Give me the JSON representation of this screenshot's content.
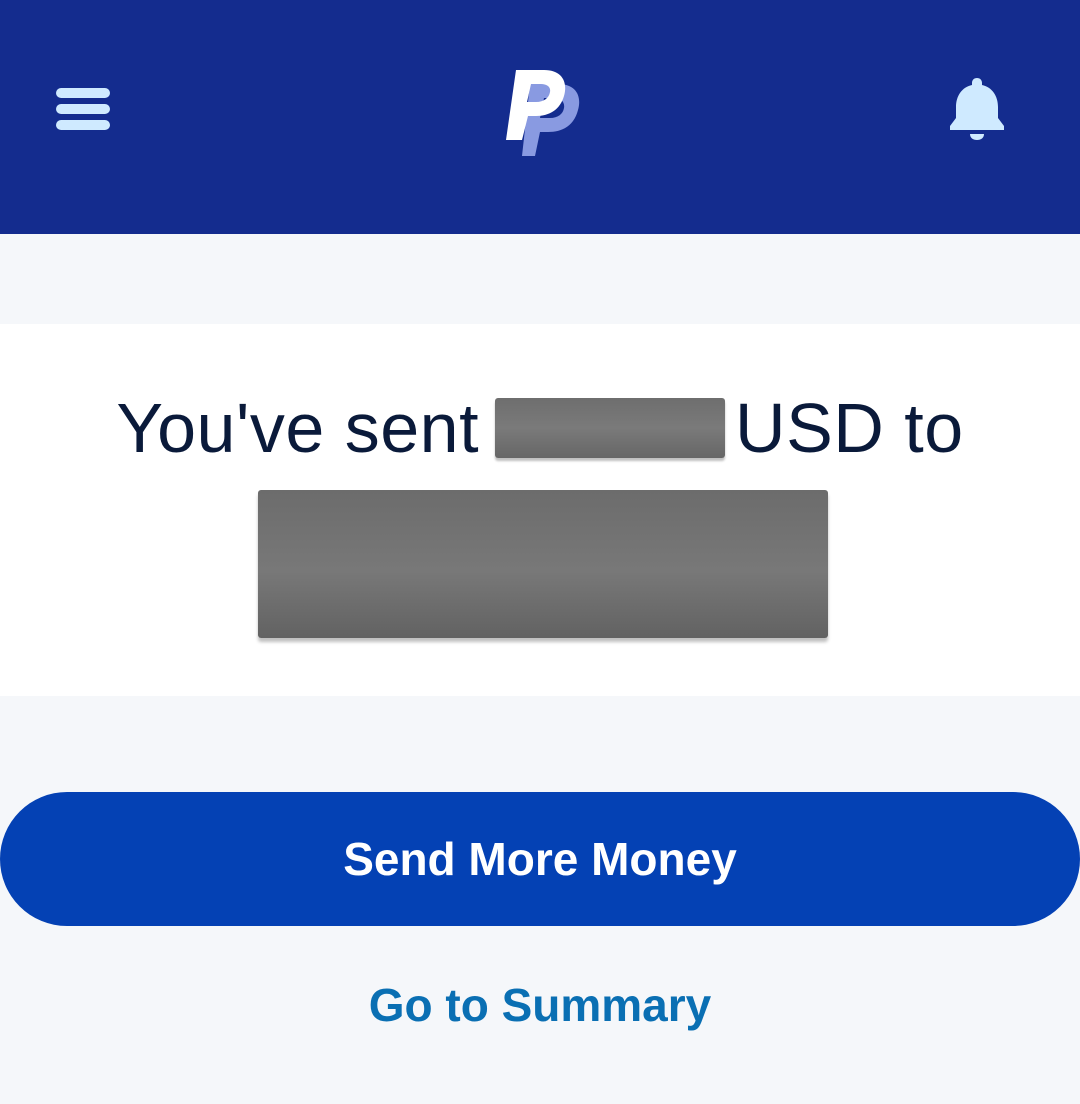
{
  "header": {
    "menu_icon": "hamburger-menu-icon",
    "logo_icon": "paypal-logo-icon",
    "notification_icon": "bell-icon"
  },
  "message": {
    "prefix": "You've sent",
    "currency_suffix": "USD to"
  },
  "actions": {
    "send_more_label": "Send More Money",
    "summary_label": "Go to Summary"
  },
  "colors": {
    "header_bg": "#142c8e",
    "primary_button": "#0441b4",
    "link": "#0a6fb3",
    "icon_light": "#cfeaff",
    "page_bg": "#f5f7fa"
  }
}
